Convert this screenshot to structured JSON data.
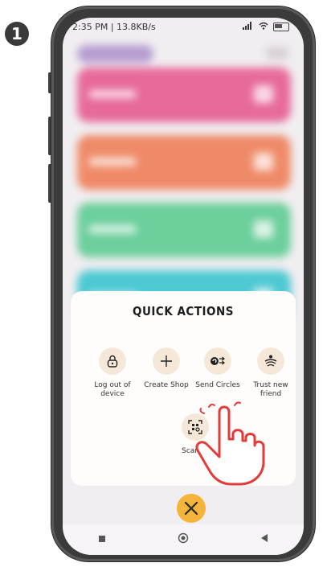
{
  "step_badge": "1",
  "status_bar": {
    "time_info": "2:35 PM | 13.8KB/s"
  },
  "quick_actions": {
    "title": "QUICK ACTIONS",
    "actions": [
      {
        "label": "Log out of device",
        "icon": "lock-icon"
      },
      {
        "label": "Create Shop",
        "icon": "plus-icon"
      },
      {
        "label": "Send Circles",
        "icon": "send-circles-icon"
      },
      {
        "label": "Trust new friend",
        "icon": "trust-icon"
      },
      {
        "label": "Scan to",
        "icon": "qr-scan-icon"
      }
    ]
  },
  "background_cards": {
    "colors": [
      "#e76a9a",
      "#ef8a68",
      "#6ccf9c",
      "#4ec9d2"
    ]
  },
  "accent_colors": {
    "close_fab": "#f4b33a",
    "icon_bg": "#f5e8d8",
    "pointer_outline": "#e33a3a"
  },
  "nav_bar": {
    "icons": [
      "recents-square-icon",
      "home-circle-icon",
      "back-triangle-icon"
    ]
  }
}
